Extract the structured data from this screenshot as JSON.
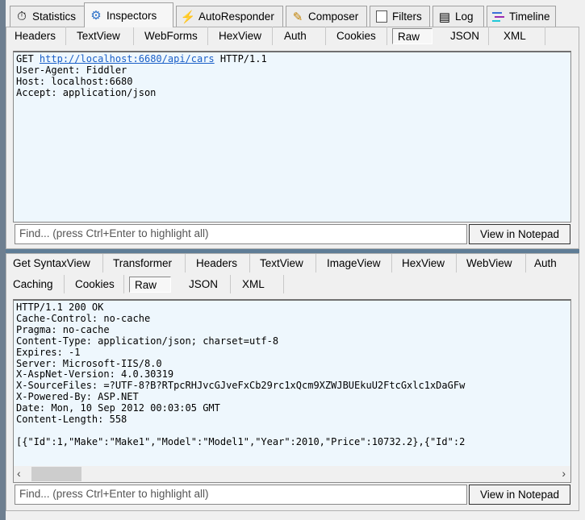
{
  "main_tabs": [
    {
      "label": "Statistics",
      "icon": "stopwatch-icon",
      "selected": false
    },
    {
      "label": "Inspectors",
      "icon": "inspectors-icon",
      "selected": true
    },
    {
      "label": "AutoResponder",
      "icon": "lightning-icon",
      "selected": false
    },
    {
      "label": "Composer",
      "icon": "compose-icon",
      "selected": false
    },
    {
      "label": "Filters",
      "icon": "checkbox-icon",
      "selected": false
    },
    {
      "label": "Log",
      "icon": "log-icon",
      "selected": false
    },
    {
      "label": "Timeline",
      "icon": "timeline-icon",
      "selected": false
    }
  ],
  "request": {
    "tabs": [
      "Headers",
      "TextView",
      "WebForms",
      "HexView",
      "Auth",
      "Cookies",
      "Raw",
      "JSON",
      "XML"
    ],
    "selected_tab": "Raw",
    "method": "GET",
    "url": "http://localhost:6680/api/cars",
    "protocol": "HTTP/1.1",
    "lines": [
      "User-Agent: Fiddler",
      "Host: localhost:6680",
      "Accept: application/json"
    ],
    "find_placeholder": "Find... (press Ctrl+Enter to highlight all)",
    "notepad_button": "View in Notepad"
  },
  "response": {
    "tabs_row1": [
      "Get SyntaxView",
      "Transformer",
      "Headers",
      "TextView",
      "ImageView",
      "HexView",
      "WebView",
      "Auth"
    ],
    "tabs_row2": [
      "Caching",
      "Cookies",
      "Raw",
      "JSON",
      "XML"
    ],
    "selected_tab": "Raw",
    "lines": [
      "HTTP/1.1 200 OK",
      "Cache-Control: no-cache",
      "Pragma: no-cache",
      "Content-Type: application/json; charset=utf-8",
      "Expires: -1",
      "Server: Microsoft-IIS/8.0",
      "X-AspNet-Version: 4.0.30319",
      "X-SourceFiles: =?UTF-8?B?RTpcRHJvcGJveFxCb29rc1xQcm9XZWJBUEkuU2FtcGxlc1xDaGFw",
      "X-Powered-By: ASP.NET",
      "Date: Mon, 10 Sep 2012 00:03:05 GMT",
      "Content-Length: 558",
      "",
      "[{\"Id\":1,\"Make\":\"Make1\",\"Model\":\"Model1\",\"Year\":2010,\"Price\":10732.2},{\"Id\":2"
    ],
    "find_placeholder": "Find... (press Ctrl+Enter to highlight all)",
    "notepad_button": "View in Notepad"
  }
}
